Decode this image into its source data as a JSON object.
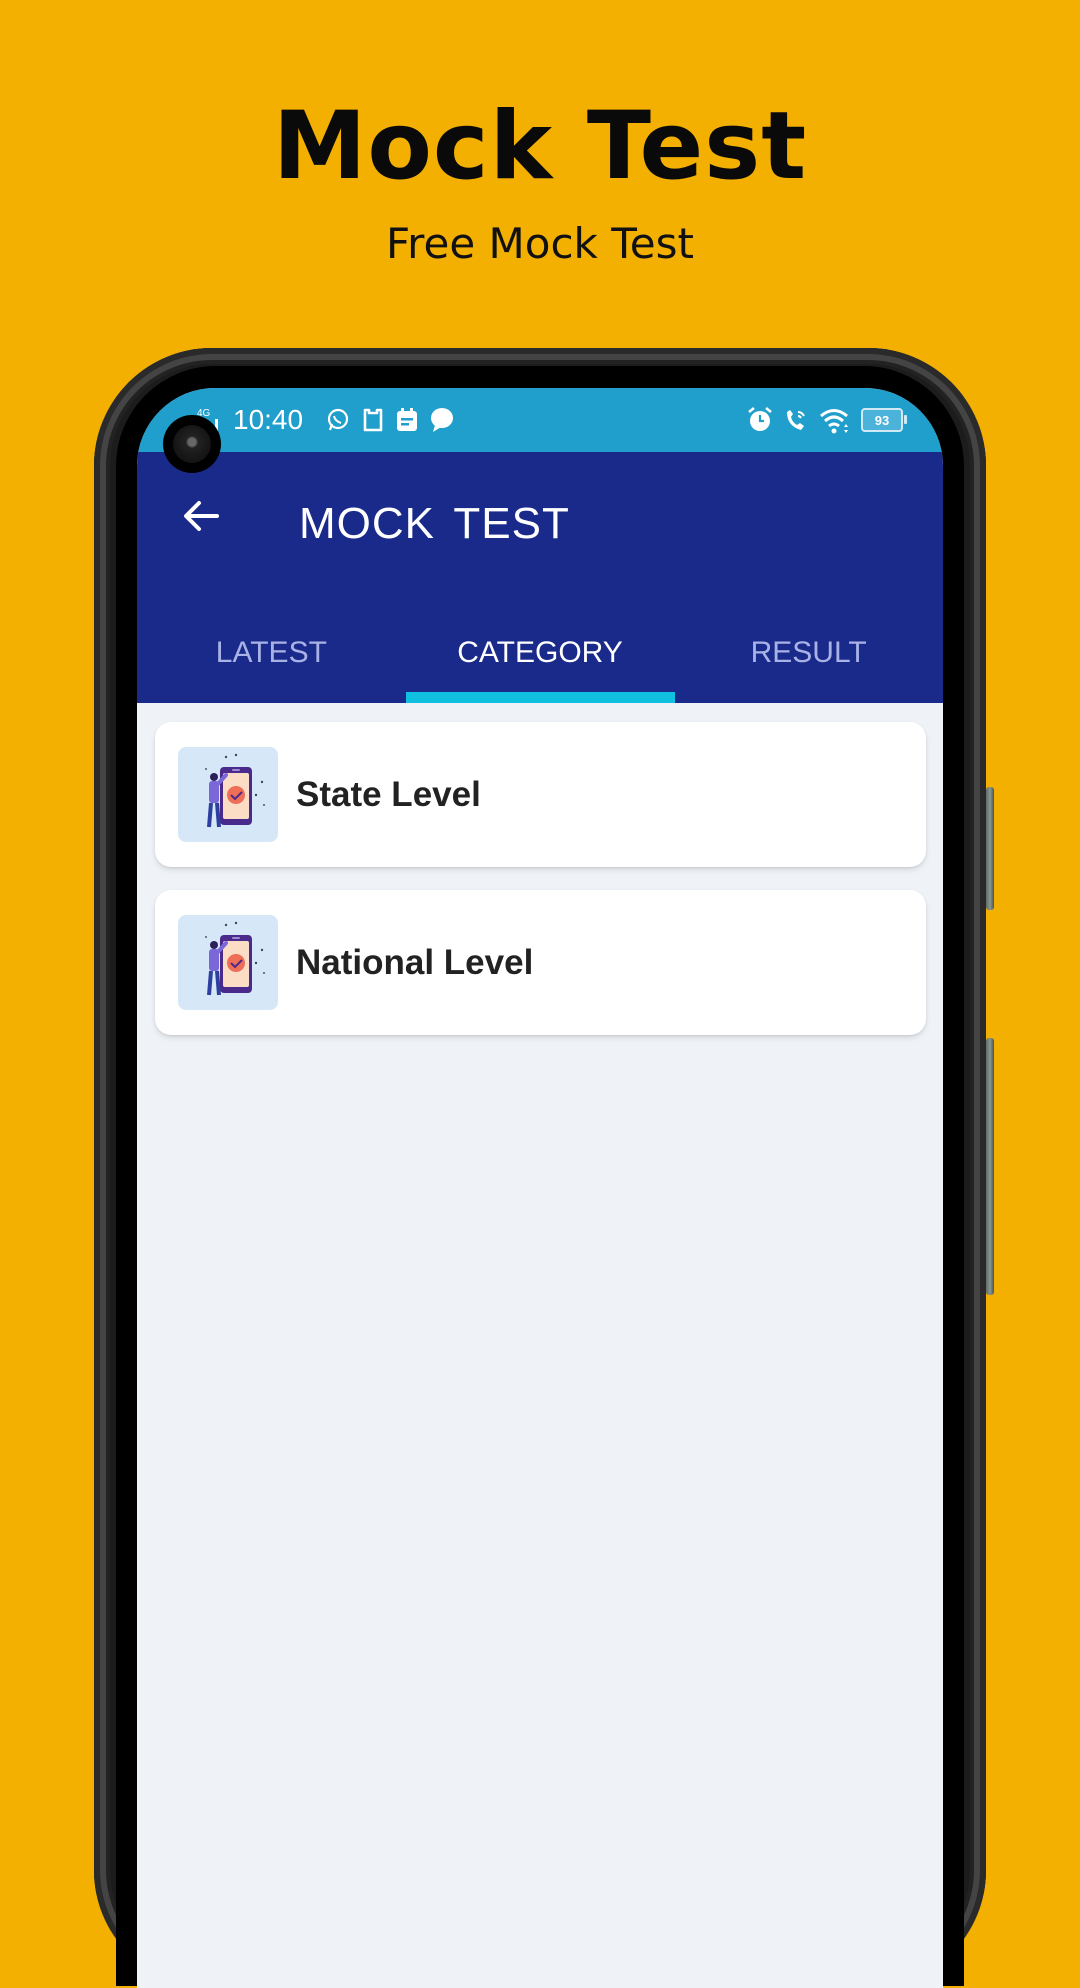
{
  "promo": {
    "title": "Mock Test",
    "subtitle": "Free Mock Test"
  },
  "status_bar": {
    "network": "4G",
    "time": "10:40",
    "left_icons": [
      "signal-icon",
      "whatsapp-icon",
      "clipboard-icon",
      "calendar-icon",
      "message-icon"
    ],
    "right_icons": [
      "alarm-icon",
      "wifi-calling-icon",
      "wifi-icon",
      "battery-icon"
    ],
    "battery_level": "93"
  },
  "app_bar": {
    "back_icon": "arrow-left-icon",
    "title": "MOCK  TEST"
  },
  "tabs": [
    {
      "label": "LATEST",
      "active": false
    },
    {
      "label": "CATEGORY",
      "active": true
    },
    {
      "label": "RESULT",
      "active": false
    }
  ],
  "categories": [
    {
      "label": "State Level",
      "icon": "mobile-test-illustration"
    },
    {
      "label": "National Level",
      "icon": "mobile-test-illustration"
    }
  ],
  "colors": {
    "background": "#F4B000",
    "status_bar": "#209ECC",
    "app_bar": "#1A2A8A",
    "tab_indicator": "#0FC0E0",
    "content_bg": "#EFF3F7"
  }
}
